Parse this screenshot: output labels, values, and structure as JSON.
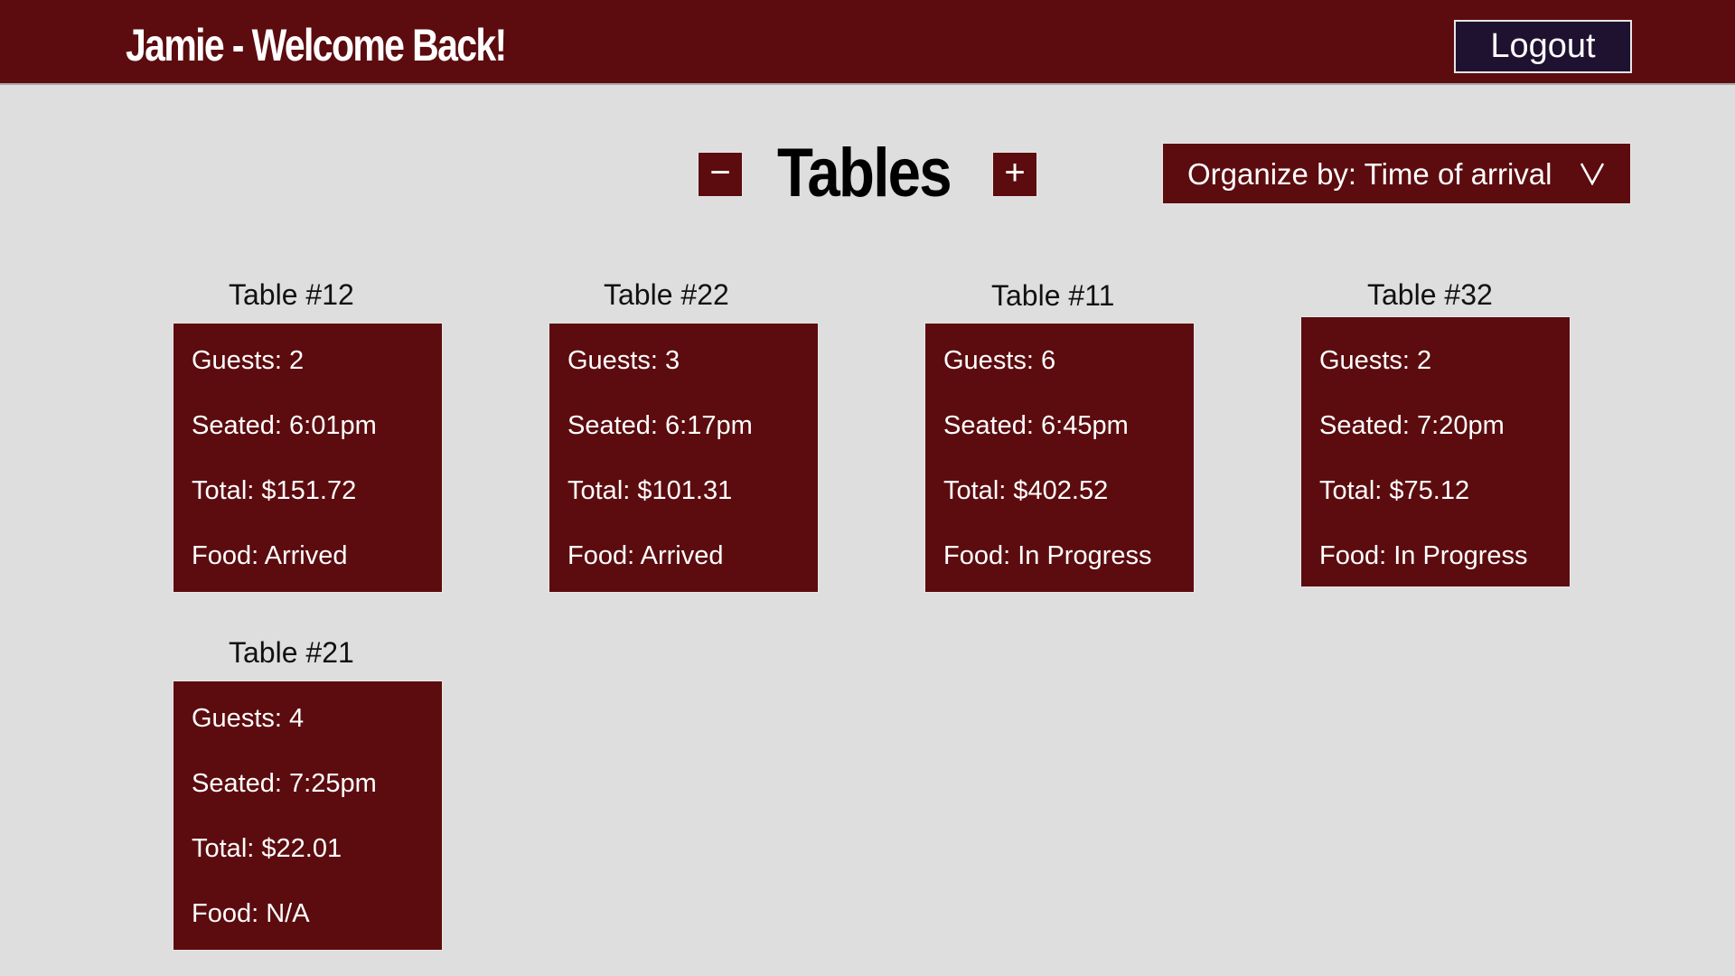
{
  "header": {
    "title": "Jamie - Welcome Back!",
    "logout_label": "Logout"
  },
  "toolbar": {
    "minus_label": "−",
    "plus_label": "+",
    "title": "Tables",
    "organize_label": "Organize by: Time of arrival",
    "organize_icon": "chevron-down-icon"
  },
  "colors": {
    "header_bg": "#5c0c0f",
    "card_bg": "#5c0c0f",
    "page_bg": "#dedede",
    "logout_bg": "#1f1230"
  },
  "tables": [
    {
      "label": "Table #12",
      "guests": "Guests: 2",
      "seated": "Seated: 6:01pm",
      "total": "Total: $151.72",
      "food": "Food: Arrived"
    },
    {
      "label": "Table #22",
      "guests": "Guests: 3",
      "seated": "Seated: 6:17pm",
      "total": "Total: $101.31",
      "food": "Food: Arrived"
    },
    {
      "label": "Table #11",
      "guests": "Guests: 6",
      "seated": "Seated: 6:45pm",
      "total": "Total: $402.52",
      "food": "Food: In Progress"
    },
    {
      "label": "Table #32",
      "guests": "Guests: 2",
      "seated": "Seated: 7:20pm",
      "total": "Total: $75.12",
      "food": "Food: In Progress"
    },
    {
      "label": "Table #21",
      "guests": "Guests: 4",
      "seated": "Seated: 7:25pm",
      "total": "Total: $22.01",
      "food": "Food: N/A"
    }
  ]
}
